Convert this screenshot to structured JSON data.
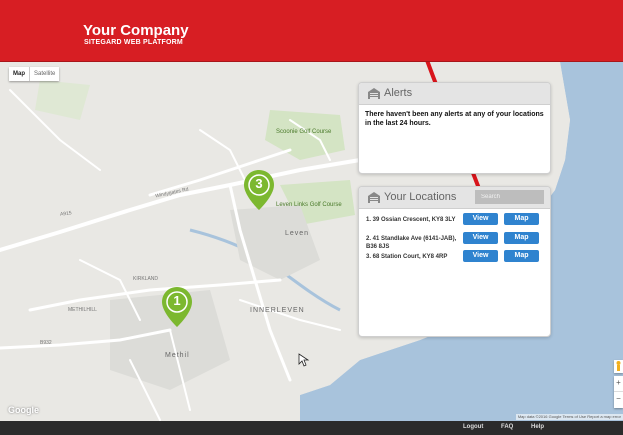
{
  "header": {
    "company": "Your Company",
    "platform": "SITEGARD WEB PLATFORM"
  },
  "map": {
    "type_controls": [
      "Map",
      "Satellite"
    ],
    "active_type": "Map",
    "labels": {
      "scoonie": "Scoonie Golf Course",
      "leven_links": "Leven Links Golf Course",
      "leven": "Leven",
      "innerleven": "INNERLEVEN",
      "methil": "Methil",
      "a915_1": "A915",
      "a915_2": "A915",
      "windygates": "Windygates Rd",
      "kirkland": "KIRKLAND",
      "methilhill": "METHILHILL",
      "b932": "B932",
      "google": "Google",
      "terms": "Map data ©2016 Google   Terms of Use   Report a map error"
    },
    "markers": [
      {
        "number": "3",
        "color": "#7cb82f"
      },
      {
        "number": "1",
        "color": "#7cb82f"
      }
    ]
  },
  "alerts": {
    "title": "Alerts",
    "message": "There haven't been any alerts at any of your locations in the last 24 hours."
  },
  "locations": {
    "title": "Your Locations",
    "search_placeholder": "Search",
    "items": [
      {
        "label": "1. 39 Ossian Crescent, KY8 3LY",
        "view": "View",
        "map": "Map"
      },
      {
        "label": "2. 41 Standlake Ave (6141-JAB), B36 8JS",
        "view": "View",
        "map": "Map"
      },
      {
        "label": "3. 68 Station Court, KY8 4RP",
        "view": "View",
        "map": "Map"
      }
    ]
  },
  "footer": {
    "logout": "Logout",
    "faq": "FAQ",
    "help": "Help"
  },
  "colors": {
    "brand_red": "#d71e23",
    "button_blue": "#2f83cf",
    "marker_green": "#7cb82f"
  }
}
